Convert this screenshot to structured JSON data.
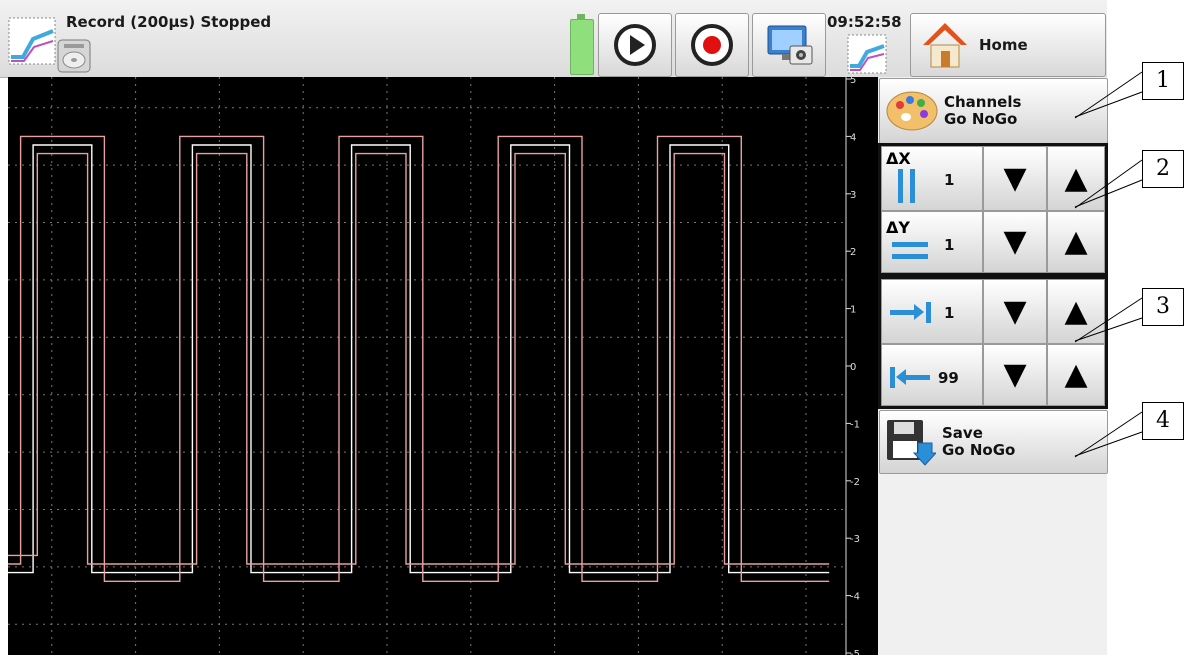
{
  "status": {
    "record_label": "Record (200µs) Stopped",
    "time": "09:52:58",
    "home_label": "Home"
  },
  "chart_data": {
    "type": "line",
    "title": "",
    "xlabel": "",
    "ylabel": "",
    "ylim": [
      -5,
      5
    ],
    "y_ticks": [
      "5",
      "4",
      "3",
      "2",
      "1",
      "0",
      "-1",
      "-2",
      "-3",
      "-4",
      "-5"
    ],
    "grid": true,
    "series": [
      {
        "color": "#ffffff",
        "points": [
          [
            0,
            -3.6
          ],
          [
            0.03,
            -3.6
          ],
          [
            0.03,
            3.85
          ],
          [
            0.1,
            3.85
          ],
          [
            0.1,
            -3.6
          ],
          [
            0.22,
            -3.6
          ],
          [
            0.22,
            3.85
          ],
          [
            0.29,
            3.85
          ],
          [
            0.29,
            -3.6
          ],
          [
            0.41,
            -3.6
          ],
          [
            0.41,
            3.85
          ],
          [
            0.48,
            3.85
          ],
          [
            0.48,
            -3.6
          ],
          [
            0.6,
            -3.6
          ],
          [
            0.6,
            3.85
          ],
          [
            0.67,
            3.85
          ],
          [
            0.67,
            -3.6
          ],
          [
            0.79,
            -3.6
          ],
          [
            0.79,
            3.85
          ],
          [
            0.86,
            3.85
          ],
          [
            0.86,
            -3.6
          ],
          [
            0.98,
            -3.6
          ]
        ]
      },
      {
        "color": "#e9a0a0",
        "points": [
          [
            0,
            -3.45
          ],
          [
            0.015,
            -3.45
          ],
          [
            0.015,
            4.0
          ],
          [
            0.115,
            4.0
          ],
          [
            0.115,
            -3.75
          ],
          [
            0.205,
            -3.75
          ],
          [
            0.205,
            4.0
          ],
          [
            0.305,
            4.0
          ],
          [
            0.305,
            -3.75
          ],
          [
            0.395,
            -3.75
          ],
          [
            0.395,
            4.0
          ],
          [
            0.495,
            4.0
          ],
          [
            0.495,
            -3.75
          ],
          [
            0.585,
            -3.75
          ],
          [
            0.585,
            4.0
          ],
          [
            0.685,
            4.0
          ],
          [
            0.685,
            -3.75
          ],
          [
            0.775,
            -3.75
          ],
          [
            0.775,
            4.0
          ],
          [
            0.875,
            4.0
          ],
          [
            0.875,
            -3.75
          ],
          [
            0.98,
            -3.75
          ]
        ]
      },
      {
        "color": "#e9a0a0",
        "points": [
          [
            0,
            -3.3
          ],
          [
            0.035,
            -3.3
          ],
          [
            0.035,
            3.7
          ],
          [
            0.095,
            3.7
          ],
          [
            0.095,
            -3.45
          ],
          [
            0.225,
            -3.45
          ],
          [
            0.225,
            3.7
          ],
          [
            0.285,
            3.7
          ],
          [
            0.285,
            -3.45
          ],
          [
            0.415,
            -3.45
          ],
          [
            0.415,
            3.7
          ],
          [
            0.475,
            3.7
          ],
          [
            0.475,
            -3.45
          ],
          [
            0.605,
            -3.45
          ],
          [
            0.605,
            3.7
          ],
          [
            0.665,
            3.7
          ],
          [
            0.665,
            -3.45
          ],
          [
            0.795,
            -3.45
          ],
          [
            0.795,
            3.7
          ],
          [
            0.855,
            3.7
          ],
          [
            0.855,
            -3.45
          ],
          [
            0.98,
            -3.45
          ]
        ]
      }
    ]
  },
  "side": {
    "channels_line1": "Channels",
    "channels_line2": "Go NoGo",
    "dx_label": "ΔX",
    "dx_value": "1",
    "dy_label": "ΔY",
    "dy_value": "1",
    "start_value": "1",
    "end_value": "99",
    "down_arrow": "▼",
    "up_arrow": "▲",
    "save_line1": "Save",
    "save_line2": "Go NoGo"
  },
  "callouts": [
    "1",
    "2",
    "3",
    "4"
  ]
}
